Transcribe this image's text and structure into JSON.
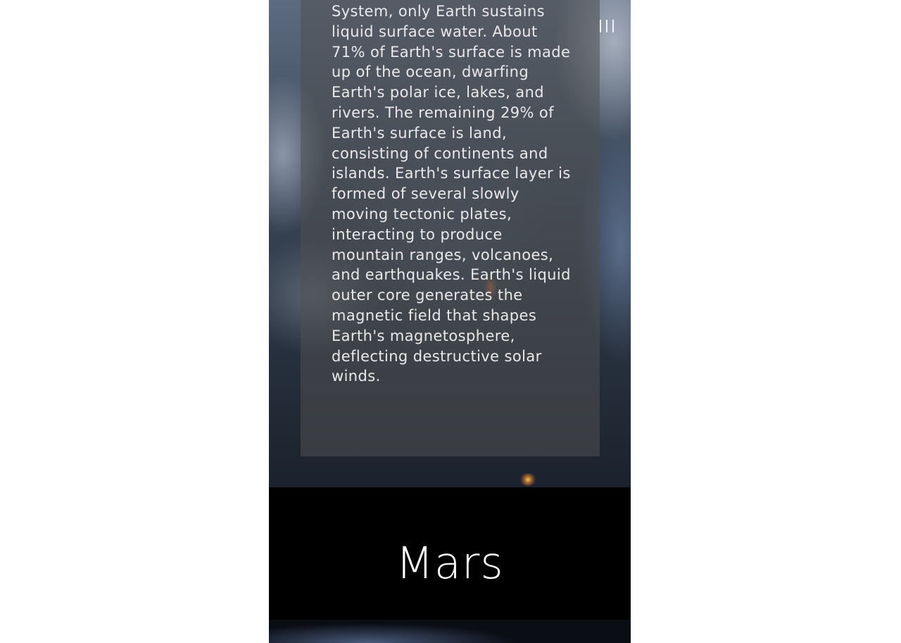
{
  "theme": {
    "page_background": "#ffffff",
    "panel_overlay": "rgba(80,80,80,0.55)",
    "text_color": "#e9e9e9",
    "section_background": "#000000",
    "title_color": "#ffffff"
  },
  "header": {
    "menu_icon": "menu-icon"
  },
  "earth_section": {
    "description": "System, only Earth sustains liquid surface water. About 71% of Earth's surface is made up of the ocean, dwarfing Earth's polar ice, lakes, and rivers. The remaining 29% of Earth's surface is land, consisting of continents and islands. Earth's surface layer is formed of several slowly moving tectonic plates, interacting to produce mountain ranges, volcanoes, and earthquakes. Earth's liquid outer core generates the magnetic field that shapes Earth's magnetosphere, deflecting destructive solar winds."
  },
  "mars_section": {
    "title": "Mars"
  }
}
